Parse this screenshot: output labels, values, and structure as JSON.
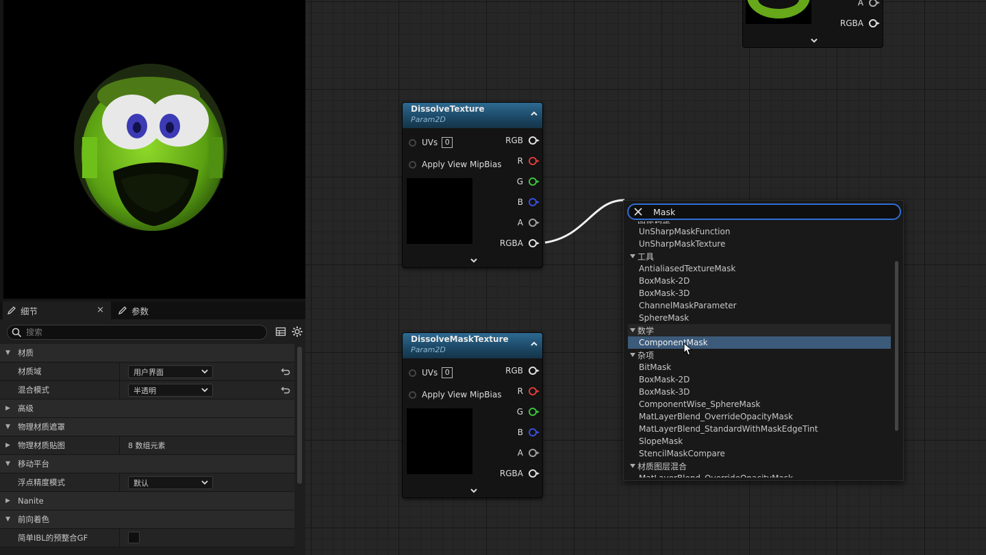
{
  "details_panel": {
    "tabs": [
      {
        "label": "细节",
        "close": "×"
      },
      {
        "label": "参数"
      }
    ],
    "search_placeholder": "搜索",
    "rows": [
      {
        "kind": "cat",
        "label": "材质",
        "expanded": true
      },
      {
        "kind": "prop",
        "label": "材质域",
        "value": "用户界面",
        "type": "dropdown",
        "reset": true
      },
      {
        "kind": "prop",
        "label": "混合模式",
        "value": "半透明",
        "type": "dropdown",
        "reset": true
      },
      {
        "kind": "cat",
        "label": "高级",
        "expanded": false
      },
      {
        "kind": "cat",
        "label": "物理材质遮罩",
        "expanded": true
      },
      {
        "kind": "prop",
        "label": "物理材质贴图",
        "value": "8 数组元素",
        "type": "text",
        "expander": true
      },
      {
        "kind": "cat",
        "label": "移动平台",
        "expanded": true
      },
      {
        "kind": "prop",
        "label": "浮点精度模式",
        "value": "默认",
        "type": "dropdown"
      },
      {
        "kind": "cat",
        "label": "Nanite",
        "expanded": false
      },
      {
        "kind": "cat",
        "label": "前向着色",
        "expanded": true
      },
      {
        "kind": "prop",
        "label": "简单IBL的预整合GF",
        "type": "checkbox"
      }
    ]
  },
  "graph": {
    "top_node": {
      "pins": [
        "A",
        "RGBA"
      ]
    },
    "nodes": [
      {
        "title": "DissolveTexture",
        "subtitle": "Param2D",
        "inputs": [
          {
            "label": "UVs",
            "value": "0"
          },
          {
            "label": "Apply View MipBias"
          }
        ],
        "outputs": [
          {
            "label": "RGB",
            "color": "#e0e0e0"
          },
          {
            "label": "R",
            "color": "#e03a3a"
          },
          {
            "label": "G",
            "color": "#3ac43a"
          },
          {
            "label": "B",
            "color": "#3a4ee0"
          },
          {
            "label": "A",
            "color": "#a0a0a0"
          },
          {
            "label": "RGBA",
            "color": "#e0e0e0"
          }
        ]
      },
      {
        "title": "DissolveMaskTexture",
        "subtitle": "Param2D",
        "inputs": [
          {
            "label": "UVs",
            "value": "0"
          },
          {
            "label": "Apply View MipBias"
          }
        ],
        "outputs": [
          {
            "label": "RGB",
            "color": "#e0e0e0"
          },
          {
            "label": "R",
            "color": "#e03a3a"
          },
          {
            "label": "G",
            "color": "#3ac43a"
          },
          {
            "label": "B",
            "color": "#3a4ee0"
          },
          {
            "label": "A",
            "color": "#a0a0a0"
          },
          {
            "label": "RGBA",
            "color": "#e0e0e0"
          }
        ]
      }
    ]
  },
  "action_menu": {
    "search_value": "Mask",
    "items": [
      {
        "kind": "cat",
        "label": "图像调整"
      },
      {
        "kind": "item",
        "label": "UnSharpMaskFunction"
      },
      {
        "kind": "item",
        "label": "UnSharpMaskTexture"
      },
      {
        "kind": "cat",
        "label": "工具"
      },
      {
        "kind": "item",
        "label": "AntialiasedTextureMask"
      },
      {
        "kind": "item",
        "label": "BoxMask-2D"
      },
      {
        "kind": "item",
        "label": "BoxMask-3D"
      },
      {
        "kind": "item",
        "label": "ChannelMaskParameter"
      },
      {
        "kind": "item",
        "label": "SphereMask"
      },
      {
        "kind": "cat",
        "label": "数学",
        "highlight": true
      },
      {
        "kind": "item",
        "label": "ComponentMask",
        "selected": true
      },
      {
        "kind": "cat",
        "label": "杂项"
      },
      {
        "kind": "item",
        "label": "BitMask"
      },
      {
        "kind": "item",
        "label": "BoxMask-2D"
      },
      {
        "kind": "item",
        "label": "BoxMask-3D"
      },
      {
        "kind": "item",
        "label": "ComponentWise_SphereMask"
      },
      {
        "kind": "item",
        "label": "MatLayerBlend_OverrideOpacityMask"
      },
      {
        "kind": "item",
        "label": "MatLayerBlend_StandardWithMaskEdgeTint"
      },
      {
        "kind": "item",
        "label": "SlopeMask"
      },
      {
        "kind": "item",
        "label": "StencilMaskCompare"
      },
      {
        "kind": "cat",
        "label": "材质图层混合"
      },
      {
        "kind": "item",
        "label": "MatLayerBlend_OverrideOpacityMask"
      }
    ]
  }
}
